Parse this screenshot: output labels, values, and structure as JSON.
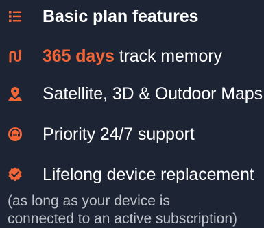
{
  "colors": {
    "background": "#1d2535",
    "accent": "#f26536",
    "text": "#ffffff",
    "note_text": "#bfc3ca"
  },
  "features": [
    {
      "icon": "list-icon",
      "text": "Basic plan features"
    },
    {
      "icon": "track-route-icon",
      "highlight": "365 days",
      "text": " track memory"
    },
    {
      "icon": "map-pin-icon",
      "text": "Satellite, 3D & Outdoor Maps"
    },
    {
      "icon": "support-headset-icon",
      "text": "Priority 24/7 support"
    },
    {
      "icon": "badge-check-icon",
      "text": "Lifelong device replacement"
    }
  ],
  "note": {
    "line1": "(as long as your device is",
    "line2": "connected to an active subscription)"
  }
}
